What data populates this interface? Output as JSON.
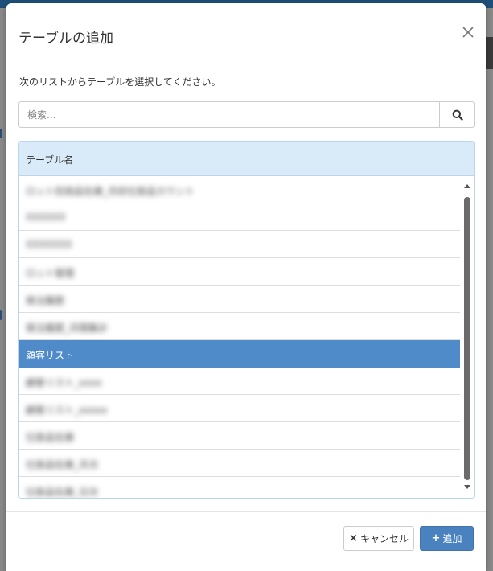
{
  "dialog": {
    "title": "テーブルの追加",
    "close_icon": "close-icon"
  },
  "instruction": "次のリストからテーブルを選択してください。",
  "search": {
    "placeholder": "検索...",
    "value": "",
    "icon": "search-icon"
  },
  "table": {
    "header": "テーブル名",
    "rows": [
      {
        "label": "ロット別商品在庫_月初仕掛品カウント",
        "selected": false
      },
      {
        "label": "XXXXXX",
        "selected": false
      },
      {
        "label": "XXXXXXX",
        "selected": false
      },
      {
        "label": "ロット管理",
        "selected": false
      },
      {
        "label": "発注履歴",
        "selected": false
      },
      {
        "label": "発注履歴_月間集計",
        "selected": false
      },
      {
        "label": "顧客リスト",
        "selected": true
      },
      {
        "label": "顧客リスト_xxxx",
        "selected": false
      },
      {
        "label": "顧客リスト_xxxxx",
        "selected": false
      },
      {
        "label": "仕掛品在庫",
        "selected": false
      },
      {
        "label": "仕掛品在庫_月次",
        "selected": false
      },
      {
        "label": "仕掛品在庫_日次",
        "selected": false
      }
    ]
  },
  "footer": {
    "cancel_label": "キャンセル",
    "cancel_icon": "×",
    "add_label": "追加",
    "add_icon": "+"
  },
  "colors": {
    "accent": "#4a82bf",
    "selected_row": "#4f8bc9",
    "table_header": "#d9eaf8"
  }
}
